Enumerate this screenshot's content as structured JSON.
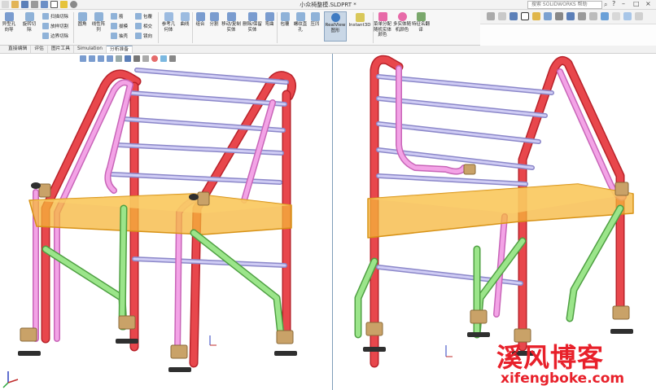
{
  "window": {
    "title": "小众椅整模.SLDPRT *",
    "search_placeholder": "搜索 SOLIDWORKS 帮助"
  },
  "ribbon": {
    "hole_wizard": "异型孔向导",
    "revolve_cut": "旋转切除",
    "scan_cut": "扫描切除",
    "loft_cut": "放样切割",
    "boundary_cut": "边界切除",
    "fillet": "圆角",
    "linear_pattern": "线性阵列",
    "rib": "筋",
    "draft": "拔模",
    "shell": "抽壳",
    "wrap": "包覆",
    "intersect": "相交",
    "mirror": "镜向",
    "ref_geometry": "参考几何体",
    "curves": "曲线",
    "combine": "组合",
    "split": "分割",
    "move_copy": "移动/复制实体",
    "delete_keep": "删除/保留实体",
    "flex": "弯曲",
    "wrap2": "包覆",
    "thread_hole": "螺纹直孔",
    "compress": "压凹",
    "realview": "RealView 图形",
    "instant3d": "Instant3D",
    "color_body": "菜单分配随机实体颜色",
    "random_color": "多实体随机颜色",
    "feature_name": "特征名翻译"
  },
  "tabs": [
    {
      "label": "直接编辑",
      "active": false
    },
    {
      "label": "评估",
      "active": false
    },
    {
      "label": "图片工具",
      "active": false
    },
    {
      "label": "Simulation",
      "active": false
    },
    {
      "label": "分析准备",
      "active": true
    }
  ],
  "watermark": {
    "cn": "溪风博客",
    "url": "xifengboke.com"
  },
  "colors": {
    "red_tube": "#e8474c",
    "pink_tube": "#f3a3e6",
    "green_tube": "#9be58a",
    "slat": "#b9b6ea",
    "seat": "#f5b63a",
    "cap": "#c9a268"
  }
}
